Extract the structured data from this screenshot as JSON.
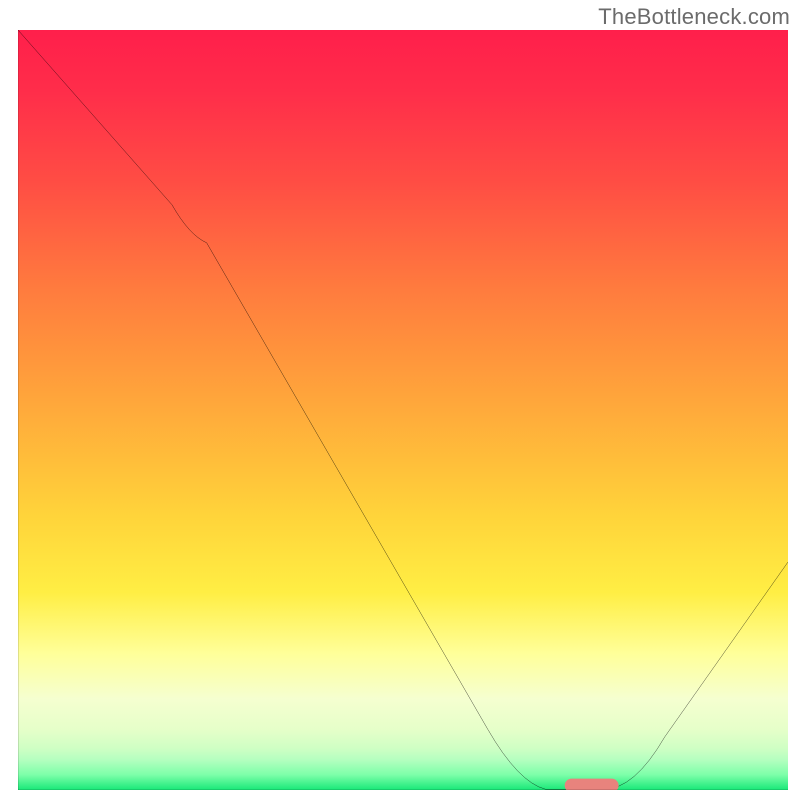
{
  "watermark": "TheBottleneck.com",
  "chart_data": {
    "type": "line",
    "title": "",
    "xlabel": "",
    "ylabel": "",
    "xlim": [
      0,
      100
    ],
    "ylim": [
      0,
      100
    ],
    "background_gradient_stops": [
      {
        "pos": 0,
        "color": "#ff1f4b"
      },
      {
        "pos": 8,
        "color": "#ff2d4a"
      },
      {
        "pos": 20,
        "color": "#ff4d44"
      },
      {
        "pos": 34,
        "color": "#ff7b3e"
      },
      {
        "pos": 48,
        "color": "#ffa43b"
      },
      {
        "pos": 64,
        "color": "#ffd43a"
      },
      {
        "pos": 74,
        "color": "#ffee44"
      },
      {
        "pos": 82,
        "color": "#ffff99"
      },
      {
        "pos": 88,
        "color": "#f5ffd0"
      },
      {
        "pos": 92,
        "color": "#e6ffc9"
      },
      {
        "pos": 94.5,
        "color": "#cfffc4"
      },
      {
        "pos": 96,
        "color": "#b5ffc0"
      },
      {
        "pos": 98,
        "color": "#7dffa9"
      },
      {
        "pos": 100,
        "color": "#18e878"
      }
    ],
    "series": [
      {
        "name": "bottleneck-curve",
        "color": "#000000",
        "x": [
          0,
          20,
          24.5,
          65,
          72,
          78,
          100
        ],
        "y": [
          100,
          77,
          72,
          1,
          0,
          0,
          30
        ]
      }
    ],
    "marker": {
      "name": "optimal-range",
      "shape": "pill",
      "color": "#e8837d",
      "x_center": 74.5,
      "y_center": 0,
      "width": 7,
      "height": 1.8
    }
  }
}
